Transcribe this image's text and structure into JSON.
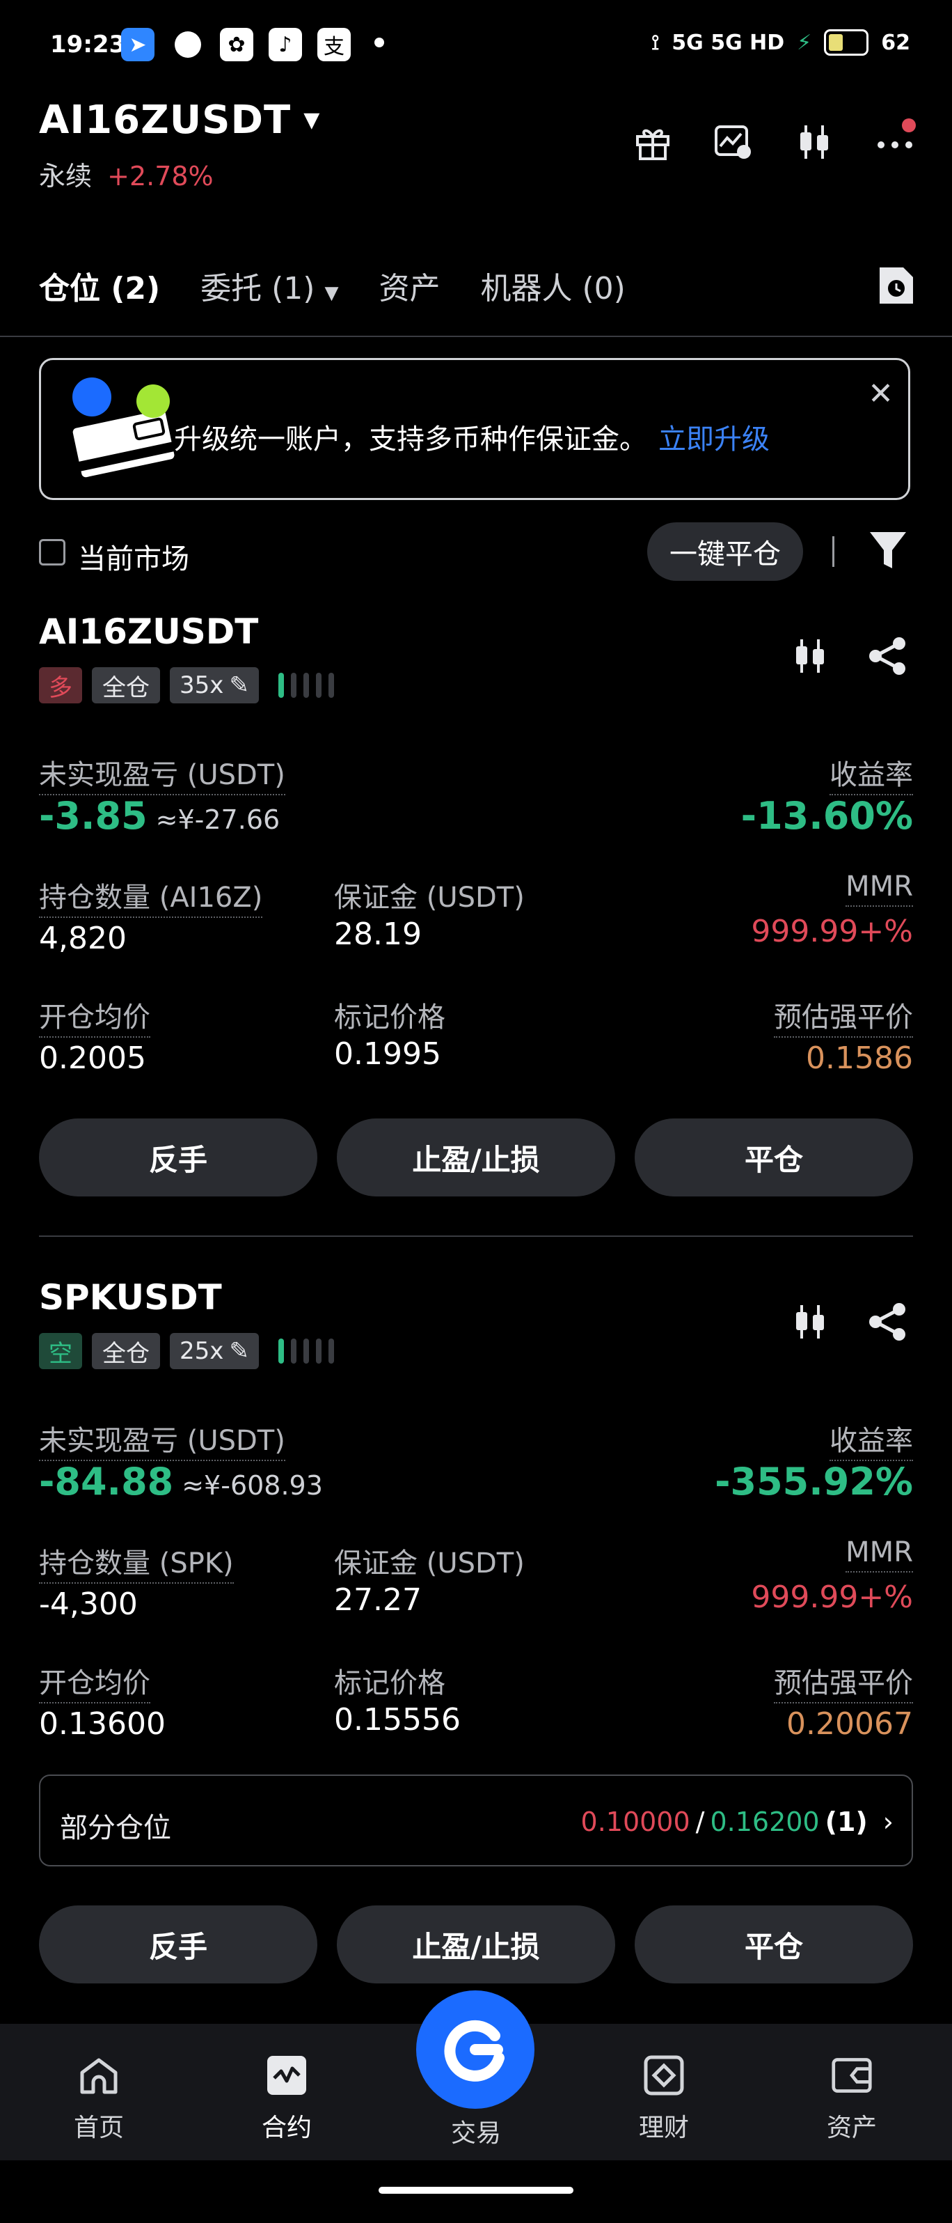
{
  "status_bar": {
    "time": "19:23",
    "network": "5G 5G HD",
    "battery": "62"
  },
  "header": {
    "symbol": "AI16ZUSDT",
    "market_type": "永续",
    "change": "+2.78%"
  },
  "tabs": [
    {
      "label": "仓位 (2)"
    },
    {
      "label": "委托 (1)"
    },
    {
      "label": "资产"
    },
    {
      "label": "机器人 (0)"
    }
  ],
  "banner": {
    "text": "升级统一账户，支持多币种作保证金。",
    "link": "立即升级"
  },
  "filter": {
    "current_market": "当前市场",
    "close_all": "一键平仓"
  },
  "positions": [
    {
      "symbol": "AI16ZUSDT",
      "side": "多",
      "margin_mode": "全仓",
      "leverage": "35x",
      "pnl_label": "未实现盈亏 (USDT)",
      "pnl": "-3.85",
      "pnl_cny": "≈¥-27.66",
      "roe_label": "收益率",
      "roe": "-13.60%",
      "qty_label": "持仓数量 (AI16Z)",
      "qty": "4,820",
      "margin_label": "保证金 (USDT)",
      "margin": "28.19",
      "mmr_label": "MMR",
      "mmr": "999.99+%",
      "entry_label": "开仓均价",
      "entry": "0.2005",
      "mark_label": "标记价格",
      "mark": "0.1995",
      "liq_label": "预估强平价",
      "liq": "0.1586",
      "btn_reverse": "反手",
      "btn_tpsl": "止盈/止损",
      "btn_close": "平仓"
    },
    {
      "symbol": "SPKUSDT",
      "side": "空",
      "margin_mode": "全仓",
      "leverage": "25x",
      "pnl_label": "未实现盈亏 (USDT)",
      "pnl": "-84.88",
      "pnl_cny": "≈¥-608.93",
      "roe_label": "收益率",
      "roe": "-355.92%",
      "qty_label": "持仓数量 (SPK)",
      "qty": "-4,300",
      "margin_label": "保证金 (USDT)",
      "margin": "27.27",
      "mmr_label": "MMR",
      "mmr": "999.99+%",
      "entry_label": "开仓均价",
      "entry": "0.13600",
      "mark_label": "标记价格",
      "mark": "0.15556",
      "liq_label": "预估强平价",
      "liq": "0.20067",
      "partial_label": "部分仓位",
      "partial_tp": "0.10000",
      "partial_sep": "/",
      "partial_sl": "0.16200",
      "partial_count": "(1)",
      "btn_reverse": "反手",
      "btn_tpsl": "止盈/止损",
      "btn_close": "平仓"
    }
  ],
  "bottom_nav": [
    {
      "label": "首页",
      "icon": "home-icon"
    },
    {
      "label": "合约",
      "icon": "futures-icon"
    },
    {
      "label": "交易",
      "icon": "trade-icon"
    },
    {
      "label": "理财",
      "icon": "earn-icon"
    },
    {
      "label": "资产",
      "icon": "wallet-icon"
    }
  ]
}
